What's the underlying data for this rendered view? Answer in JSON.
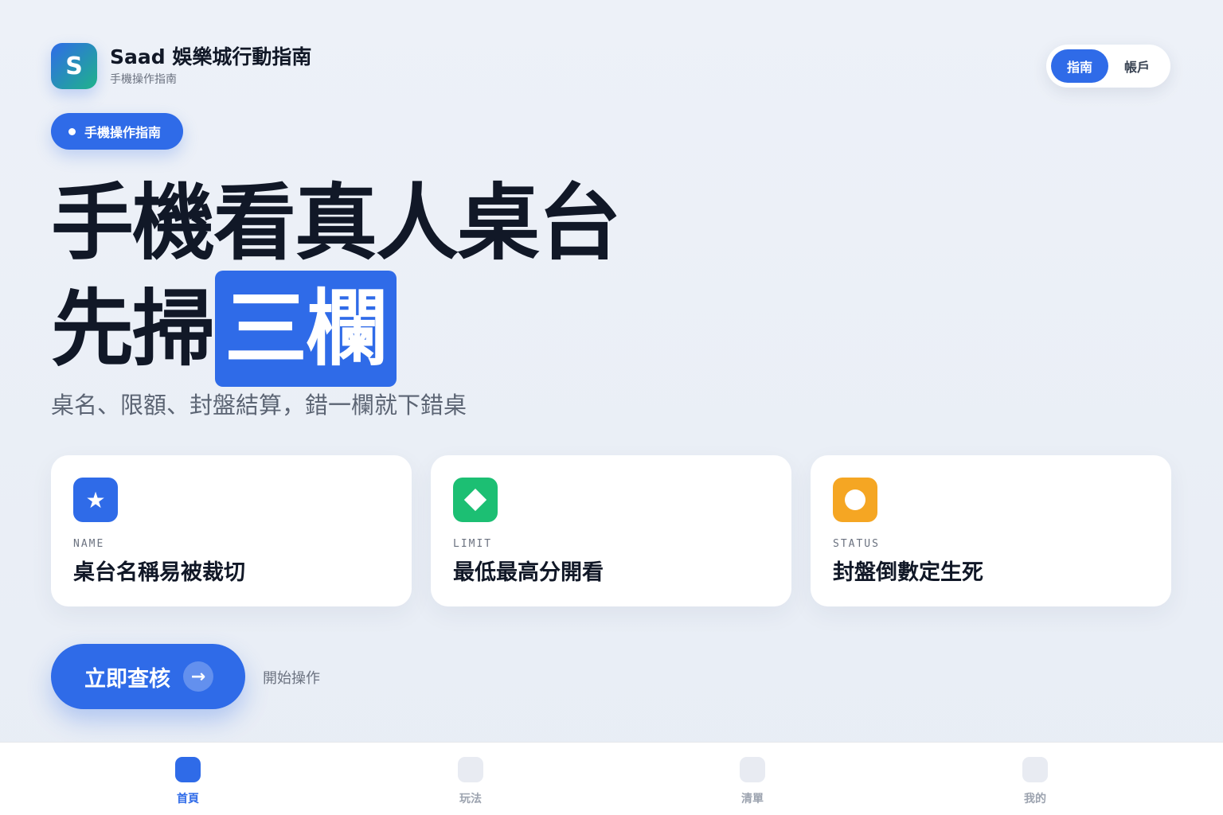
{
  "header": {
    "logo_letter": "S",
    "title": "Saad 娛樂城行動指南",
    "subtitle": "手機操作指南"
  },
  "segmented": {
    "items": [
      {
        "label": "指南",
        "active": true
      },
      {
        "label": "帳戶",
        "active": false
      }
    ]
  },
  "badge": {
    "label": "手機操作指南"
  },
  "hero": {
    "line1": "手機看真人桌台",
    "line2_prefix": "先掃",
    "line2_highlight": "三欄"
  },
  "subtitle": "桌名、限額、封盤結算，錯一欄就下錯桌",
  "cards": [
    {
      "icon": "star-icon",
      "tag": "NAME",
      "text": "桌台名稱易被裁切",
      "color": "#2f6be8"
    },
    {
      "icon": "diamond-icon",
      "tag": "LIMIT",
      "text": "最低最高分開看",
      "color": "#1cbf73"
    },
    {
      "icon": "circle-icon",
      "tag": "STATUS",
      "text": "封盤倒數定生死",
      "color": "#f5a623"
    }
  ],
  "cta": {
    "label": "立即查核",
    "arrow": "→",
    "note": "開始操作"
  },
  "tabbar": {
    "items": [
      {
        "label": "首頁",
        "active": true
      },
      {
        "label": "玩法",
        "active": false
      },
      {
        "label": "清單",
        "active": false
      },
      {
        "label": "我的",
        "active": false
      }
    ]
  },
  "colors": {
    "accent": "#2f6be8",
    "green": "#1cbf73",
    "orange": "#f5a623",
    "text": "#111827"
  }
}
